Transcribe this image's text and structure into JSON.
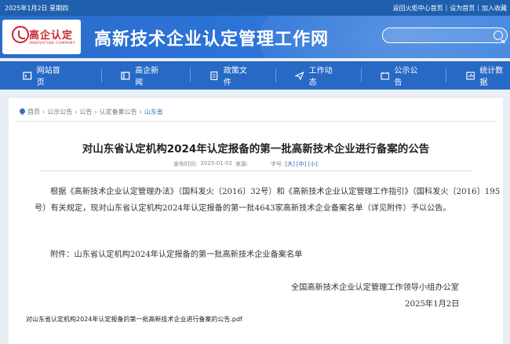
{
  "topbar": {
    "date": "2025年1月2日 星期四",
    "links": [
      "返回火炬中心首页",
      "设为首页",
      "加入收藏"
    ],
    "separator": "|"
  },
  "header": {
    "logo_text": "高企认定",
    "logo_subtext": "INNOVATION COMPANY",
    "site_title": "高新技术企业认定管理工作网",
    "search_placeholder": ""
  },
  "nav": {
    "items": [
      {
        "label": "网站首页",
        "icon": "home-icon"
      },
      {
        "label": "高企新闻",
        "icon": "news-icon"
      },
      {
        "label": "政策文件",
        "icon": "document-icon"
      },
      {
        "label": "工作动态",
        "icon": "send-icon"
      },
      {
        "label": "公示公告",
        "icon": "notice-icon"
      },
      {
        "label": "统计数据",
        "icon": "stats-icon"
      }
    ]
  },
  "breadcrumb": {
    "items": [
      "首页",
      "公示公告",
      "公告",
      "认定备案公告",
      "山东省"
    ],
    "separator": "›"
  },
  "article": {
    "title": "对山东省认定机构2024年认定报备的第一批高新技术企业进行备案的公告",
    "publish_label": "发布时间:",
    "publish_date": "2025-01-02",
    "source_label": "来源:",
    "fontsize_label": "字号:",
    "fontsize_options": [
      "[大]",
      "[中]",
      "[小]"
    ],
    "body": "根据《高新技术企业认定管理办法》（国科发火〔2016〕32号）和《高新技术企业认定管理工作指引》（国科发火〔2016〕195号）有关规定，现对山东省认定机构2024年认定报备的第一批4643家高新技术企业备案名单（详见附件）予以公告。",
    "attachment": "附件：山东省认定机构2024年认定报备的第一批高新技术企业备案名单",
    "signature": "全国高新技术企业认定管理工作领导小组办公室",
    "sign_date": "2025年1月2日",
    "pdf_link": "对山东省认定机构2024年认定报备的第一批高新技术企业进行备案的公告.pdf"
  },
  "colors": {
    "topbar_bg": "#1f5fae",
    "header_bg": "#2c73d6",
    "nav_bg": "#2769c5",
    "logo_red": "#c9252d",
    "page_bg": "#e9eef4"
  }
}
